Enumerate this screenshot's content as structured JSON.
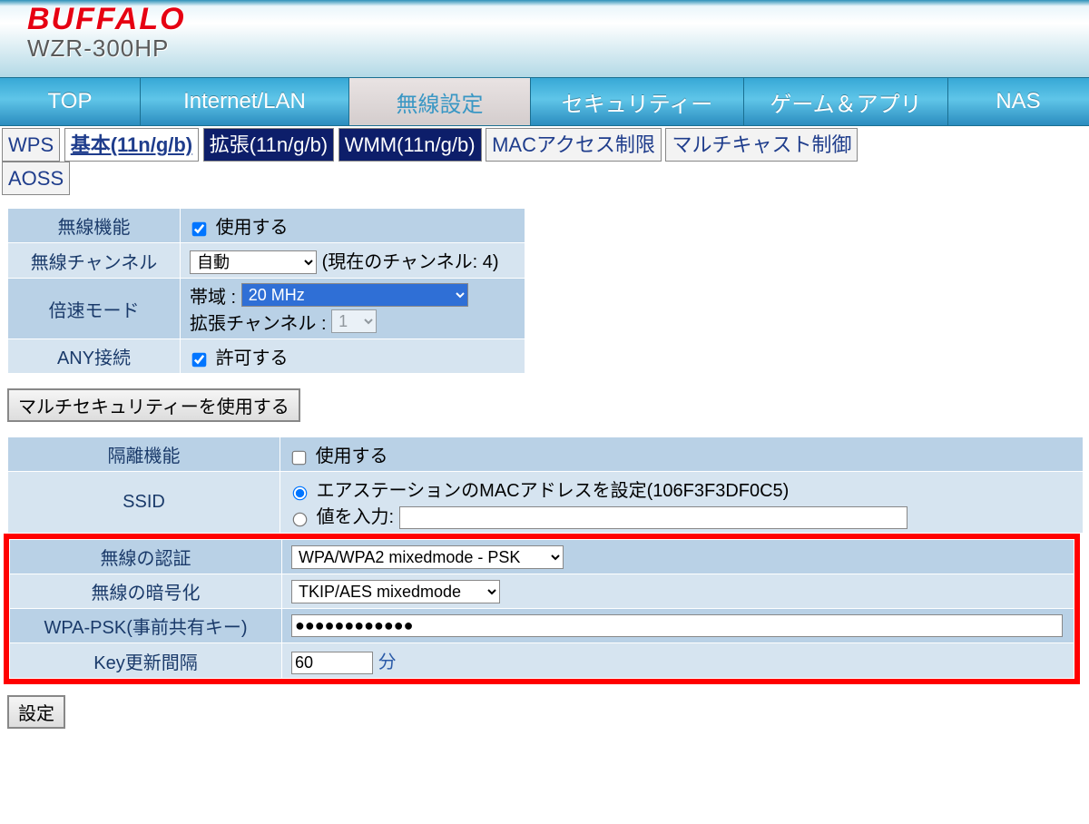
{
  "header": {
    "brand": "BUFFALO",
    "model": "WZR-300HP"
  },
  "main_tabs": {
    "top": "TOP",
    "internet_lan": "Internet/LAN",
    "wireless": "無線設定",
    "security": "セキュリティー",
    "game_apps": "ゲーム＆アプリ",
    "nas": "NAS"
  },
  "sub_tabs": {
    "wps": "WPS",
    "basic": "基本(11n/g/b)",
    "ext": "拡張(11n/g/b)",
    "wmm": "WMM(11n/g/b)",
    "mac": "MACアクセス制限",
    "multicast": "マルチキャスト制御",
    "aoss": "AOSS"
  },
  "table1": {
    "wireless_func": {
      "label": "無線機能",
      "cb": "使用する"
    },
    "channel": {
      "label": "無線チャンネル",
      "select": "自動",
      "note": "(現在のチャンネル: 4)"
    },
    "turbo": {
      "label": "倍速モード",
      "band_lbl": "帯域 :",
      "band_val": "20 MHz",
      "extch_lbl": "拡張チャンネル :",
      "extch_val": "1"
    },
    "any": {
      "label": "ANY接続",
      "cb": "許可する"
    }
  },
  "multi_button": "マルチセキュリティーを使用する",
  "table2": {
    "isolate": {
      "label": "隔離機能",
      "cb": "使用する"
    },
    "ssid": {
      "label": "SSID",
      "opt1": "エアステーションのMACアドレスを設定(106F3F3DF0C5)",
      "opt2": "値を入力:"
    },
    "auth": {
      "label": "無線の認証",
      "val": "WPA/WPA2 mixedmode - PSK"
    },
    "enc": {
      "label": "無線の暗号化",
      "val": "TKIP/AES mixedmode"
    },
    "psk": {
      "label": "WPA-PSK(事前共有キー)",
      "val": "●●●●●●●●●●●●"
    },
    "rekey": {
      "label": "Key更新間隔",
      "val": "60",
      "unit": "分"
    }
  },
  "apply": "設定"
}
